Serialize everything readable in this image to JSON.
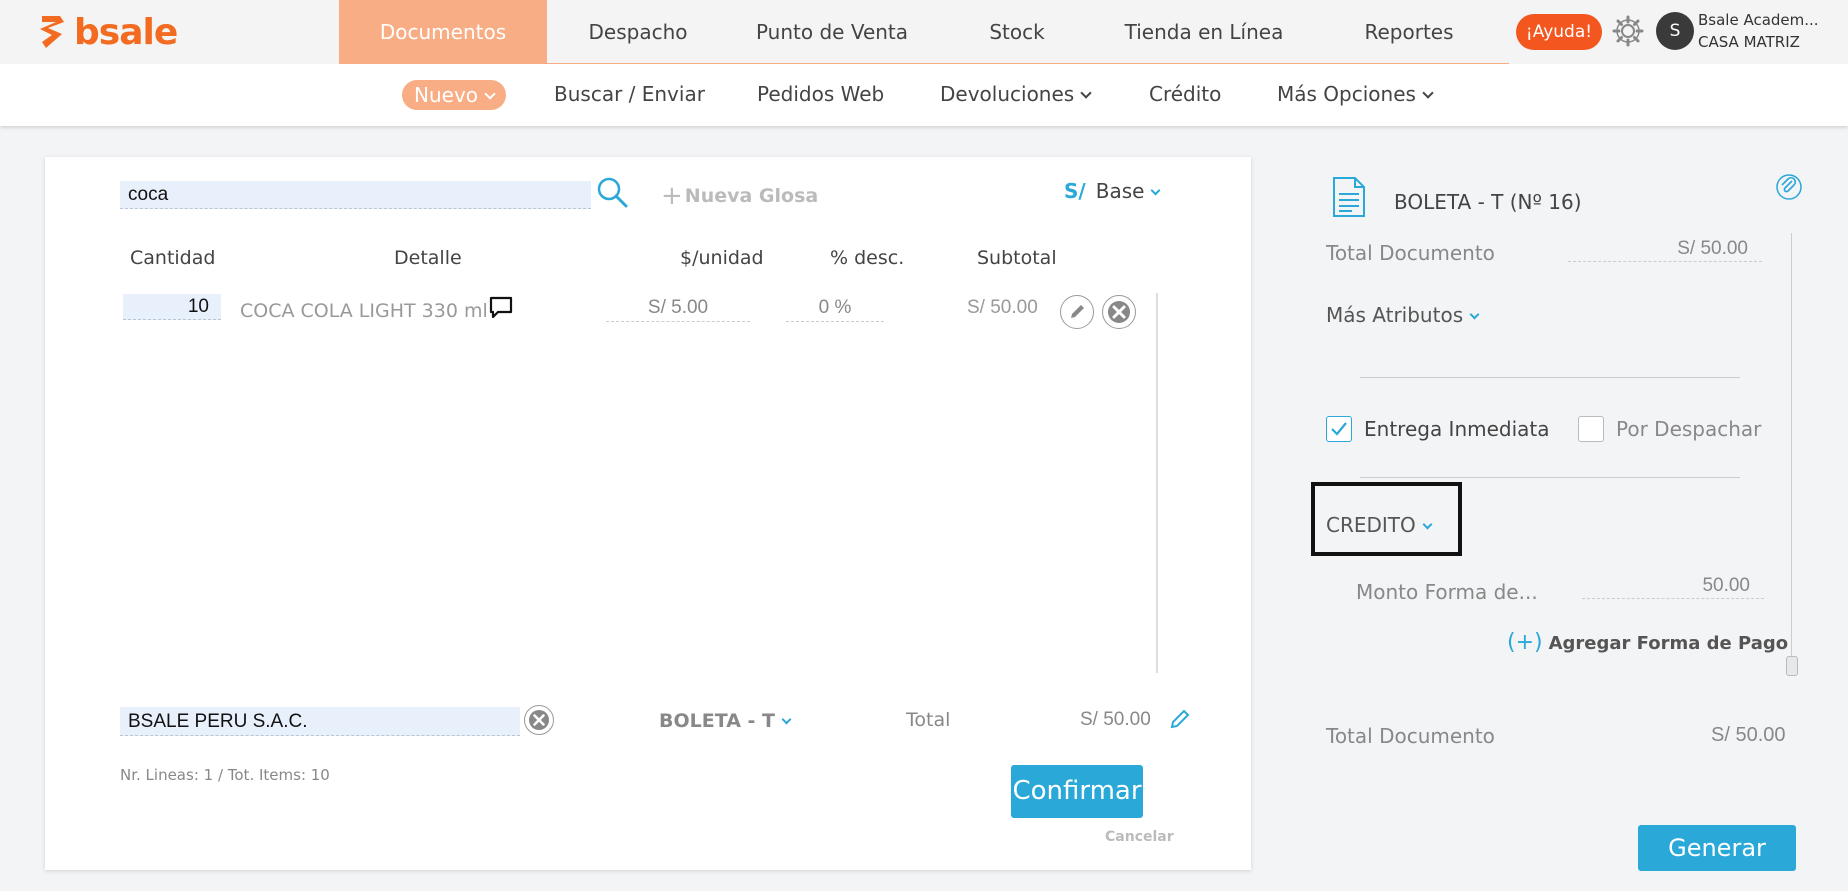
{
  "brand": {
    "name": "bsale",
    "color": "#f26b21"
  },
  "main_nav": {
    "items": [
      {
        "label": "Documentos",
        "active": true
      },
      {
        "label": "Despacho"
      },
      {
        "label": "Punto de Venta"
      },
      {
        "label": "Stock"
      },
      {
        "label": "Tienda en Línea"
      },
      {
        "label": "Reportes"
      }
    ]
  },
  "header": {
    "help_label": "¡Ayuda!",
    "settings_icon": "gear-icon",
    "avatar_initial": "S",
    "user_name": "Bsale Academ...",
    "branch": "CASA MATRIZ"
  },
  "sub_nav": {
    "items": [
      {
        "label": "Nuevo",
        "active": true,
        "dropdown": true
      },
      {
        "label": "Buscar / Enviar"
      },
      {
        "label": "Pedidos Web"
      },
      {
        "label": "Devoluciones",
        "dropdown": true
      },
      {
        "label": "Crédito"
      },
      {
        "label": "Más Opciones",
        "dropdown": true
      }
    ]
  },
  "editor": {
    "search_value": "coca",
    "new_glosa_label": "Nueva Glosa",
    "currency_symbol": "S/",
    "price_list": "Base",
    "columns": {
      "qty": "Cantidad",
      "detail": "Detalle",
      "unit_price": "$/unidad",
      "discount": "% desc.",
      "subtotal": "Subtotal"
    },
    "rows": [
      {
        "qty": "10",
        "detail": "COCA COLA LIGHT 330 ml",
        "unit_price": "S/ 5.00",
        "discount": "0 %",
        "subtotal": "S/ 50.00"
      }
    ],
    "client": "BSALE PERU S.A.C.",
    "doc_type": "BOLETA - T",
    "total_label": "Total",
    "total_value": "S/ 50.00",
    "lines_info": "Nr. Lineas: 1 / Tot. Items: 10",
    "confirm_label": "Confirmar",
    "cancel_label": "Cancelar"
  },
  "summary": {
    "doc_title": "BOLETA - T (Nº 16)",
    "total_doc_label": "Total Documento",
    "total_doc_value": "S/ 50.00",
    "more_attributes_label": "Más Atributos",
    "immediate_delivery_label": "Entrega Inmediata",
    "immediate_delivery_checked": true,
    "to_dispatch_label": "Por Despachar",
    "to_dispatch_checked": false,
    "payment_method": "CREDITO",
    "payment_amount_label": "Monto Forma de...",
    "payment_amount_value": "50.00",
    "add_payment_label": "Agregar Forma de Pago",
    "footer_total_label": "Total Documento",
    "footer_total_value": "S/ 50.00",
    "generate_label": "Generar"
  },
  "colors": {
    "accent": "#2aa8d8",
    "nav_active": "#f9ad85",
    "help": "#f3561e"
  }
}
